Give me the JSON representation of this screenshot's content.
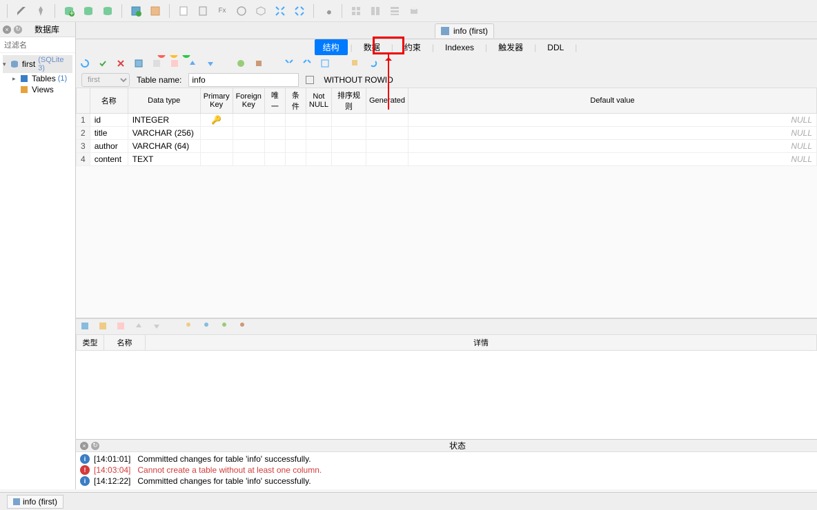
{
  "sidebar": {
    "title": "数据库",
    "filter_placeholder": "过滤名",
    "db_name": "first",
    "db_type": "(SQLite 3)",
    "tables_label": "Tables",
    "tables_count": "(1)",
    "views_label": "Views"
  },
  "doc_tab": "info (first)",
  "tabs": {
    "structure": "结构",
    "data": "数据",
    "constraints": "约束",
    "indexes": "Indexes",
    "triggers": "触发器",
    "ddl": "DDL"
  },
  "namebar": {
    "db_value": "first",
    "table_label": "Table name:",
    "table_value": "info",
    "rowid_label": "WITHOUT ROWID"
  },
  "grid": {
    "headers": {
      "name": "名称",
      "type": "Data type",
      "pk": "Primary\nKey",
      "fk": "Foreign\nKey",
      "unique": "唯一",
      "cond": "条件",
      "notnull": "Not\nNULL",
      "sort": "排序规则",
      "gen": "Generated",
      "default": "Default value"
    },
    "rows": [
      {
        "n": "1",
        "name": "id",
        "type": "INTEGER",
        "pk": true,
        "def": "NULL"
      },
      {
        "n": "2",
        "name": "title",
        "type": "VARCHAR (256)",
        "pk": false,
        "def": "NULL"
      },
      {
        "n": "3",
        "name": "author",
        "type": "VARCHAR (64)",
        "pk": false,
        "def": "NULL"
      },
      {
        "n": "4",
        "name": "content",
        "type": "TEXT",
        "pk": false,
        "def": "NULL"
      }
    ]
  },
  "subgrid": {
    "type": "类型",
    "name": "名称",
    "detail": "详情"
  },
  "status": {
    "title": "状态",
    "logs": [
      {
        "type": "info",
        "time": "[14:01:01]",
        "msg": "Committed changes for table 'info' successfully."
      },
      {
        "type": "err",
        "time": "[14:03:04]",
        "msg": "Cannot create a table without at least one column."
      },
      {
        "type": "info",
        "time": "[14:12:22]",
        "msg": "Committed changes for table 'info' successfully."
      }
    ]
  },
  "bottombar_tab": "info (first)"
}
